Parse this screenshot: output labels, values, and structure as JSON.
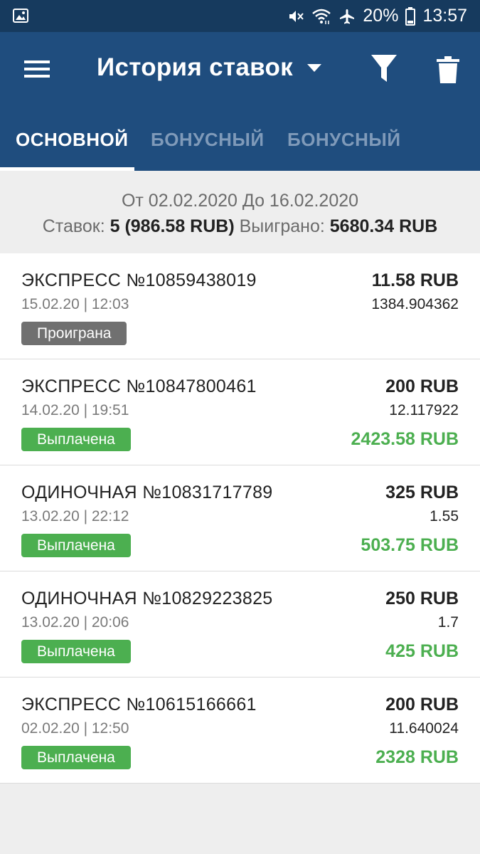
{
  "status_bar": {
    "battery": "20%",
    "time": "13:57",
    "icons": [
      "gallery-icon",
      "mute-icon",
      "wifi-icon",
      "airplane-icon",
      "battery-icon"
    ]
  },
  "app_bar": {
    "title": "История ставок",
    "icons": [
      "menu-icon",
      "caret-down-icon",
      "filter-icon",
      "trash-icon"
    ]
  },
  "tabs": [
    {
      "label": "ОСНОВНОЙ",
      "active": true
    },
    {
      "label": "БОНУСНЫЙ",
      "active": false
    },
    {
      "label": "БОНУСНЫЙ",
      "active": false
    }
  ],
  "summary": {
    "range": "От 02.02.2020 До 16.02.2020",
    "bets_label": "Ставок:",
    "bets_value": "5 (986.58 RUB)",
    "won_label": "Выиграно:",
    "won_value": "5680.34 RUB"
  },
  "bets": [
    {
      "name": "ЭКСПРЕСС №10859438019",
      "date": "15.02.20 | 12:03",
      "status": "Проиграна",
      "status_color": "#707070",
      "stake": "11.58 RUB",
      "odds": "1384.904362",
      "win": ""
    },
    {
      "name": "ЭКСПРЕСС №10847800461",
      "date": "14.02.20 | 19:51",
      "status": "Выплачена",
      "status_color": "#4caf50",
      "stake": "200 RUB",
      "odds": "12.117922",
      "win": "2423.58 RUB"
    },
    {
      "name": "ОДИНОЧНАЯ №10831717789",
      "date": "13.02.20 | 22:12",
      "status": "Выплачена",
      "status_color": "#4caf50",
      "stake": "325 RUB",
      "odds": "1.55",
      "win": "503.75 RUB"
    },
    {
      "name": "ОДИНОЧНАЯ №10829223825",
      "date": "13.02.20 | 20:06",
      "status": "Выплачена",
      "status_color": "#4caf50",
      "stake": "250 RUB",
      "odds": "1.7",
      "win": "425 RUB"
    },
    {
      "name": "ЭКСПРЕСС №10615166661",
      "date": "02.02.20 | 12:50",
      "status": "Выплачена",
      "status_color": "#4caf50",
      "stake": "200 RUB",
      "odds": "11.640024",
      "win": "2328 RUB"
    }
  ],
  "colors": {
    "primary": "#1f4d7e",
    "status_bar": "#163a5e",
    "win_green": "#4caf50",
    "lost_gray": "#707070",
    "inactive_tab": "#7f9ab9"
  }
}
